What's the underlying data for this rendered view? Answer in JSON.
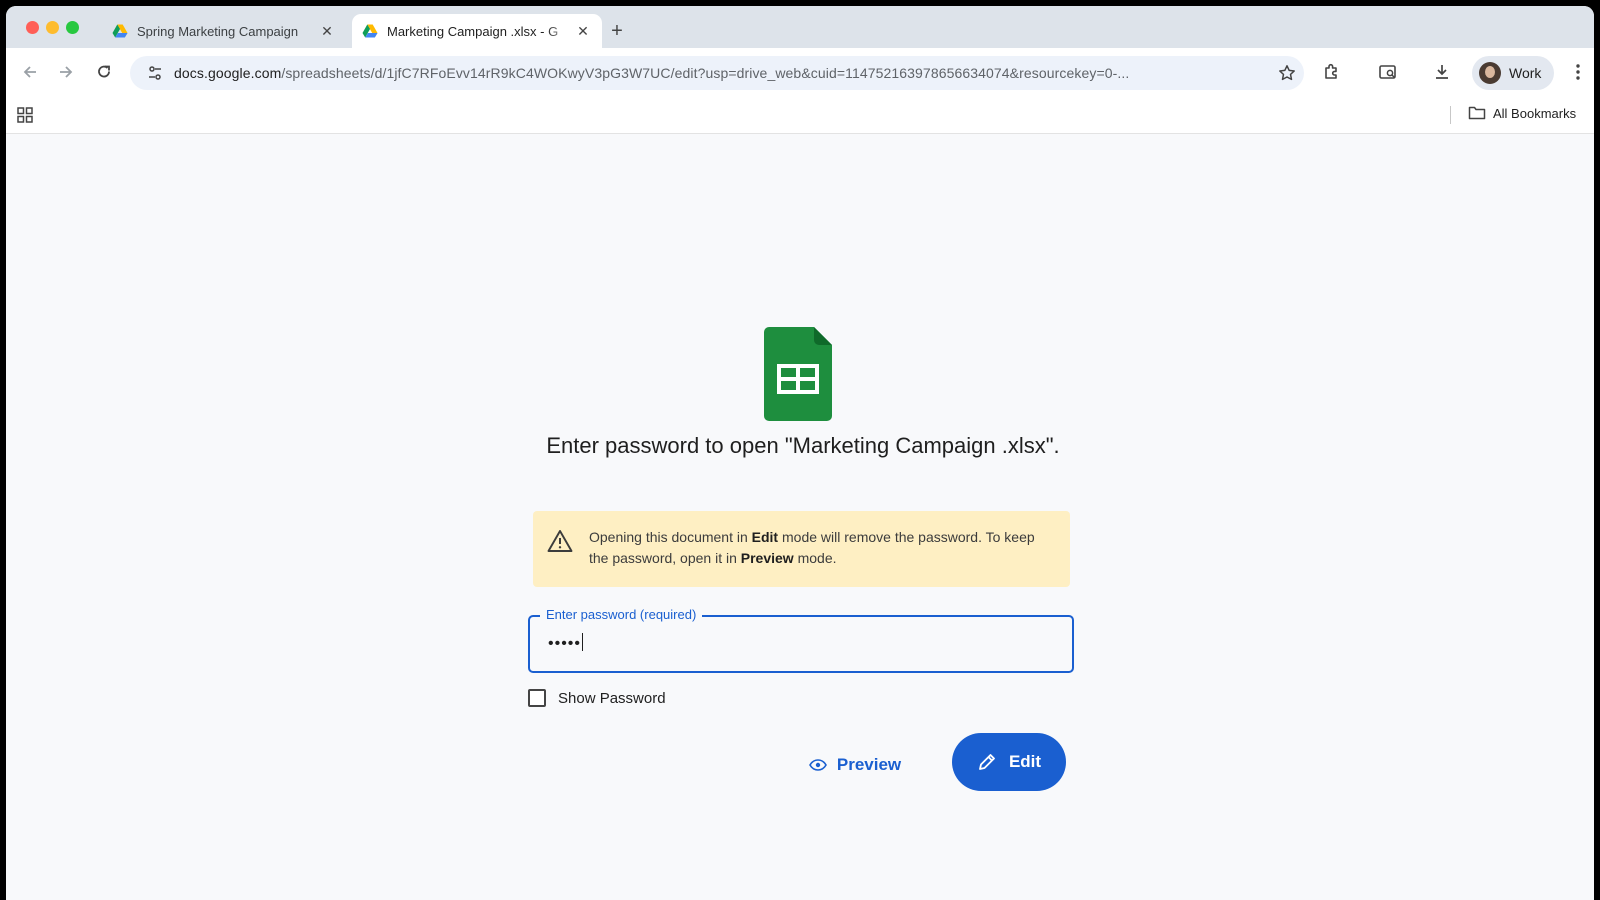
{
  "browser": {
    "tabs": [
      {
        "title": "Spring Marketing Campaign",
        "active": false
      },
      {
        "title": "Marketing Campaign .xlsx - G",
        "active": true
      }
    ],
    "url_domain": "docs.google.com",
    "url_path": "/spreadsheets/d/1jfC7RFoEvv14rR9kC4WOKwyV3pG3W7UC/edit?usp=drive_web&cuid=114752163978656634074&resourcekey=0-...",
    "profile_label": "Work",
    "bookmarks_label": "All Bookmarks"
  },
  "dialog": {
    "prompt": "Enter password to open \"Marketing Campaign .xlsx\".",
    "warning_part1": "Opening this document in ",
    "warning_bold1": "Edit",
    "warning_part2": " mode will remove the password. To keep the password, open it in ",
    "warning_bold2": "Preview",
    "warning_part3": " mode.",
    "password_label": "Enter password (required)",
    "password_value": "•••••",
    "show_password_label": "Show Password",
    "preview_label": "Preview",
    "edit_label": "Edit"
  },
  "colors": {
    "accent": "#1a5fd0",
    "sheets_green": "#1e8e3e",
    "warning_bg": "#feefc3"
  }
}
